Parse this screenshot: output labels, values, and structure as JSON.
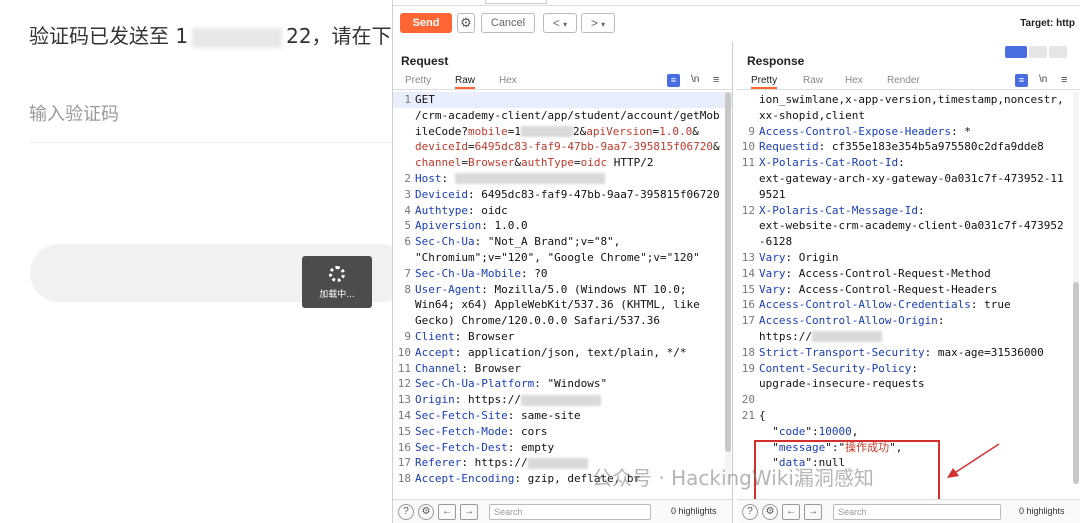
{
  "background_page": {
    "title_prefix": "验证码已发送至 1",
    "title_suffix": "22，请在",
    "title_tail": "下",
    "input_placeholder": "输入验证码",
    "toast_text": "加载中..."
  },
  "toolbar": {
    "send_label": "Send",
    "cancel_label": "Cancel",
    "back_label": "<",
    "forward_label": ">",
    "target_label": "Target: http"
  },
  "request": {
    "title": "Request",
    "tabs": [
      "Pretty",
      "Raw",
      "Hex"
    ],
    "active_tab": "Raw",
    "lines": [
      {
        "n": "1",
        "html": "GET"
      },
      {
        "n": "",
        "html": "/crm-academy-client/app/student/account/getMob"
      },
      {
        "n": "",
        "html": "ileCode?<span class='pr'>mobile</span>=1<span class='redact' style='width:52px'></span>2&amp;<span class='pr'>apiVersion</span>=<span class='pr'>1.0.0</span>&amp;"
      },
      {
        "n": "",
        "html": "<span class='pr'>deviceId</span>=<span class='pr'>6495dc83-faf9-47bb-9aa7-395815f06720</span>&amp;"
      },
      {
        "n": "",
        "html": "<span class='pr'>channel</span>=<span class='pr'>Browser</span>&amp;<span class='pr'>authType</span>=<span class='pr'>oidc</span> HTTP/2"
      },
      {
        "n": "2",
        "html": "<span class='hn'>Host</span>: <span class='redact' style='width:150px'></span>"
      },
      {
        "n": "3",
        "html": "<span class='hn'>Deviceid</span>: 6495dc83-faf9-47bb-9aa7-395815f06720"
      },
      {
        "n": "4",
        "html": "<span class='hn'>Authtype</span>: oidc"
      },
      {
        "n": "5",
        "html": "<span class='hn'>Apiversion</span>: 1.0.0"
      },
      {
        "n": "6",
        "html": "<span class='hn'>Sec-Ch-Ua</span>: \"Not_A Brand\";v=\"8\","
      },
      {
        "n": "",
        "html": "\"Chromium\";v=\"120\", \"Google Chrome\";v=\"120\""
      },
      {
        "n": "7",
        "html": "<span class='hn'>Sec-Ch-Ua-Mobile</span>: ?0"
      },
      {
        "n": "8",
        "html": "<span class='hn'>User-Agent</span>: Mozilla/5.0 (Windows NT 10.0;"
      },
      {
        "n": "",
        "html": "Win64; x64) AppleWebKit/537.36 (KHTML, like"
      },
      {
        "n": "",
        "html": "Gecko) Chrome/120.0.0.0 Safari/537.36"
      },
      {
        "n": "9",
        "html": "<span class='hn'>Client</span>: Browser"
      },
      {
        "n": "10",
        "html": "<span class='hn'>Accept</span>: application/json, text/plain, */*"
      },
      {
        "n": "11",
        "html": "<span class='hn'>Channel</span>: Browser"
      },
      {
        "n": "12",
        "html": "<span class='hn'>Sec-Ch-Ua-Platform</span>: \"Windows\""
      },
      {
        "n": "13",
        "html": "<span class='hn'>Origin</span>: https://<span class='redact' style='width:80px'></span>"
      },
      {
        "n": "14",
        "html": "<span class='hn'>Sec-Fetch-Site</span>: same-site"
      },
      {
        "n": "15",
        "html": "<span class='hn'>Sec-Fetch-Mode</span>: cors"
      },
      {
        "n": "16",
        "html": "<span class='hn'>Sec-Fetch-Dest</span>: empty"
      },
      {
        "n": "17",
        "html": "<span class='hn'>Referer</span>: https://<span class='redact' style='width:60px'></span>"
      },
      {
        "n": "18",
        "html": "<span class='hn'>Accept-Encoding</span>: gzip, deflate, br"
      }
    ],
    "search_placeholder": "Search",
    "highlights": "0 highlights"
  },
  "response": {
    "title": "Response",
    "tabs": [
      "Pretty",
      "Raw",
      "Hex",
      "Render"
    ],
    "active_tab": "Pretty",
    "lines": [
      {
        "n": "",
        "html": "ion_swimlane,x-app-version,timestamp,noncestr,"
      },
      {
        "n": "",
        "html": "xx-shopid,client"
      },
      {
        "n": "9",
        "html": "<span class='hn'>Access-Control-Expose-Headers</span>: *"
      },
      {
        "n": "10",
        "html": "<span class='hn'>Requestid</span>: cf355e183e354b5a975580c2dfa9dde8"
      },
      {
        "n": "11",
        "html": "<span class='hn'>X-Polaris-Cat-Root-Id</span>:"
      },
      {
        "n": "",
        "html": "ext-gateway-arch-xy-gateway-0a031c7f-473952-11"
      },
      {
        "n": "",
        "html": "9521"
      },
      {
        "n": "12",
        "html": "<span class='hn'>X-Polaris-Cat-Message-Id</span>:"
      },
      {
        "n": "",
        "html": "ext-website-crm-academy-client-0a031c7f-473952"
      },
      {
        "n": "",
        "html": "-6128"
      },
      {
        "n": "13",
        "html": "<span class='hn'>Vary</span>: Origin"
      },
      {
        "n": "14",
        "html": "<span class='hn'>Vary</span>: Access-Control-Request-Method"
      },
      {
        "n": "15",
        "html": "<span class='hn'>Vary</span>: Access-Control-Request-Headers"
      },
      {
        "n": "16",
        "html": "<span class='hn'>Access-Control-Allow-Credentials</span>: true"
      },
      {
        "n": "17",
        "html": "<span class='hn'>Access-Control-Allow-Origin</span>:"
      },
      {
        "n": "",
        "html": "https://<span class='redact' style='width:70px'></span>"
      },
      {
        "n": "18",
        "html": "<span class='hn'>Strict-Transport-Security</span>: max-age=31536000"
      },
      {
        "n": "19",
        "html": "<span class='hn'>Content-Security-Policy</span>:"
      },
      {
        "n": "",
        "html": "upgrade-insecure-requests"
      },
      {
        "n": "20",
        "html": ""
      },
      {
        "n": "21",
        "html": "{"
      },
      {
        "n": "",
        "html": "  \"<span class='jsonkey'>code</span>\":<span class='jsonkey'>10000</span>,"
      },
      {
        "n": "",
        "html": "  \"<span class='jsonkey'>message</span>\":\"<span class='jsonval'>操作成功</span>\","
      },
      {
        "n": "",
        "html": "  \"<span class='jsonkey'>data</span>\":null"
      }
    ],
    "search_placeholder": "Search",
    "highlights": "0 highlights"
  },
  "watermark": "公众号 · HackingWiki漏洞感知",
  "colors": {
    "accent": "#ff6633",
    "header_blue": "#1a3db8",
    "param_red": "#c0392b",
    "box_red": "#d32f2f"
  }
}
